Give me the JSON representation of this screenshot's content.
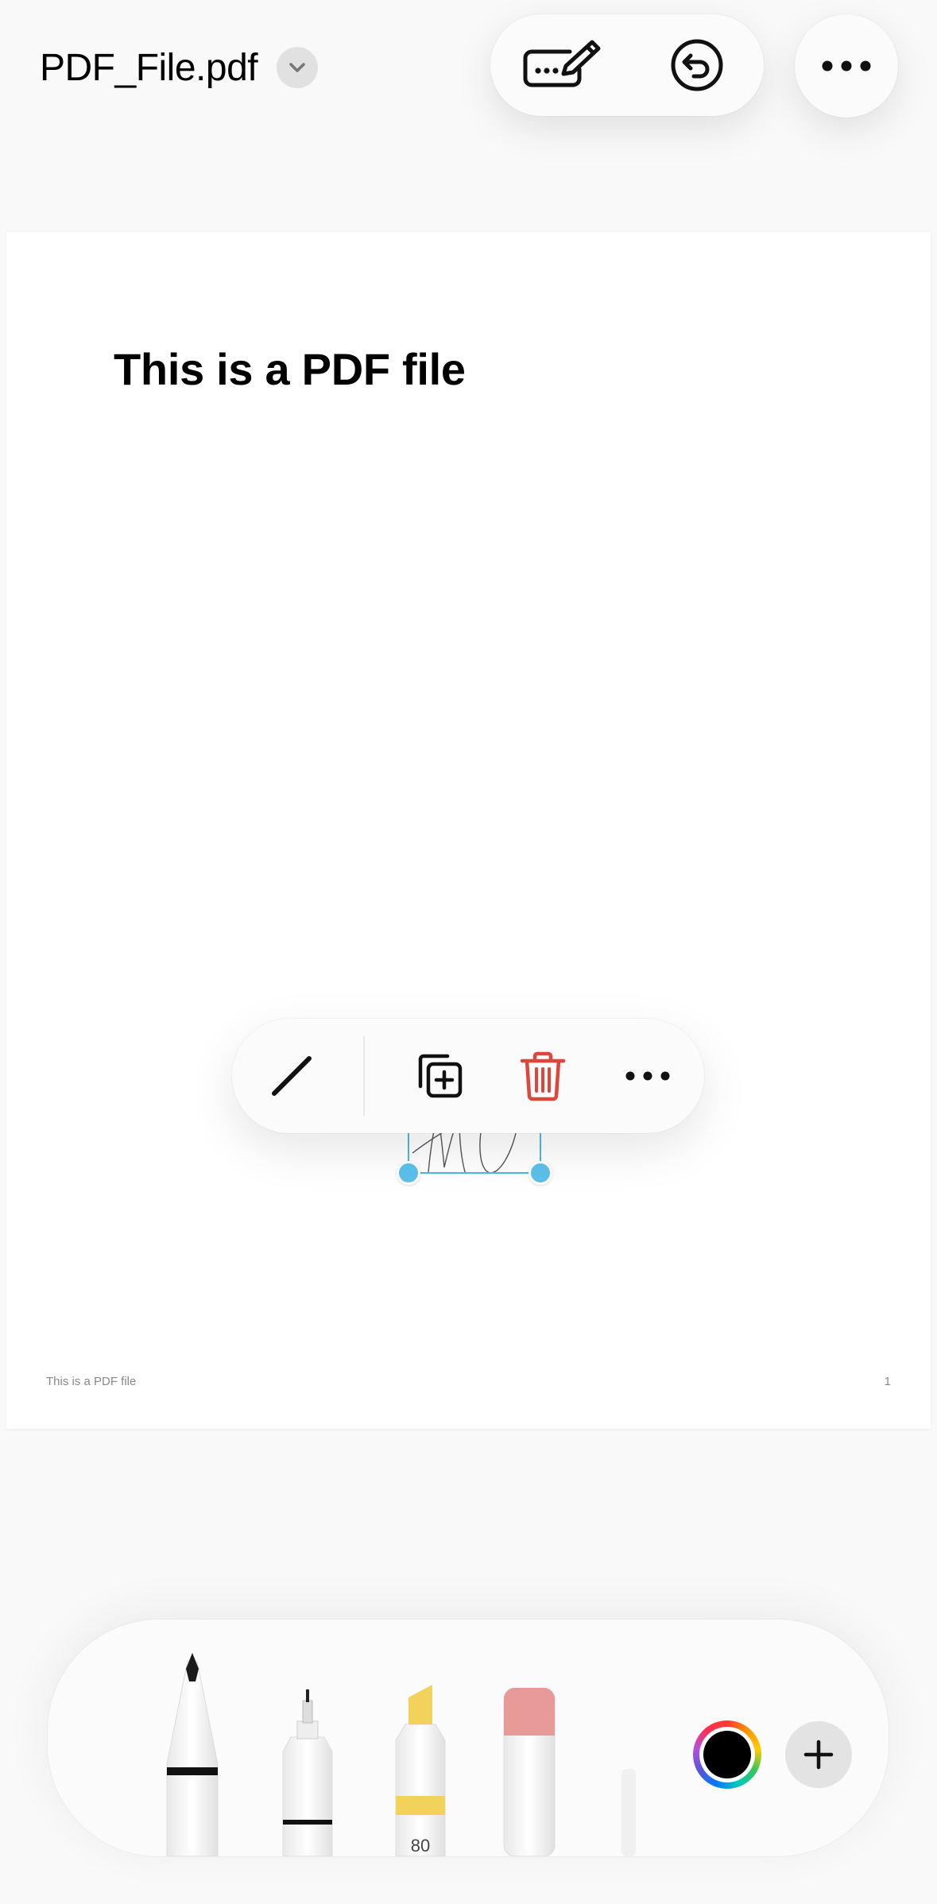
{
  "header": {
    "file_name": "PDF_File.pdf"
  },
  "toolbar": {
    "icons": [
      "signature-icon",
      "undo-icon",
      "more-icon"
    ]
  },
  "document": {
    "heading": "This is a PDF file",
    "footer_left": "This is a PDF file",
    "page_number": "1"
  },
  "selection_menu": {
    "icons": [
      "pen-line-icon",
      "duplicate-icon",
      "trash-icon",
      "more-icon"
    ],
    "delete_color": "#e0453b"
  },
  "tools": {
    "highlighter_opacity": "80",
    "selected_color": "#000000",
    "selection_color": "#4ab8e6",
    "eraser_color": "#e89a98",
    "highlighter_color": "#f2d25a"
  }
}
